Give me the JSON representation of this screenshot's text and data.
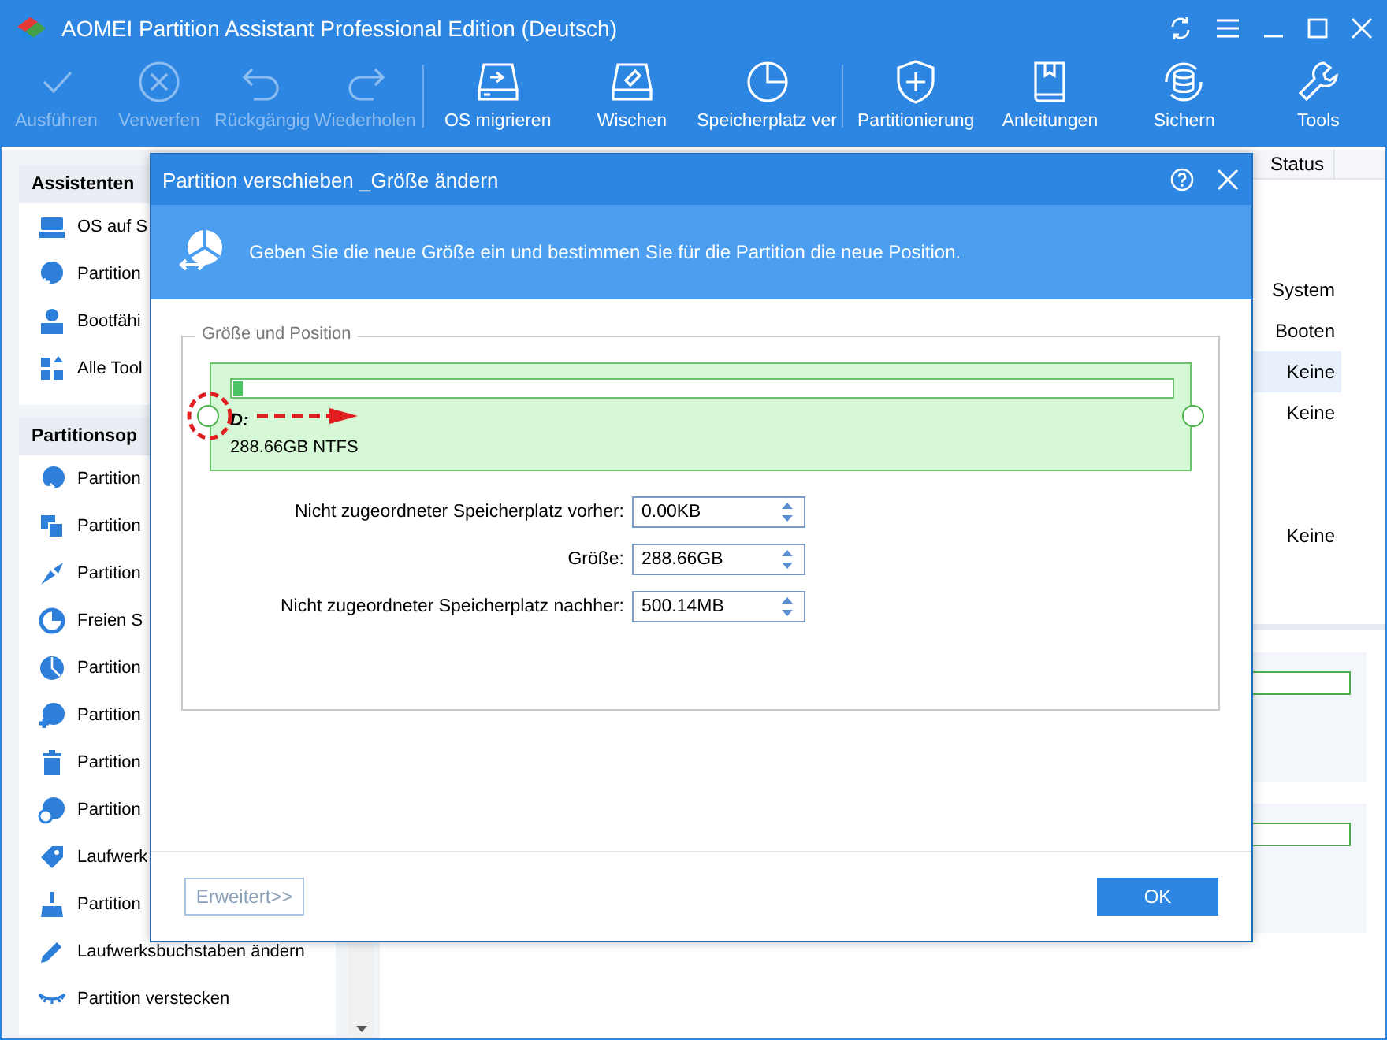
{
  "window": {
    "title": "AOMEI Partition Assistant Professional Edition (Deutsch)"
  },
  "toolbar": [
    [
      {
        "label": "Ausführen",
        "disabled": true
      },
      {
        "label": "Verwerfen",
        "disabled": true
      },
      {
        "label": "Rückgängig",
        "disabled": true
      },
      {
        "label": "Wiederholen",
        "disabled": true
      }
    ],
    [
      {
        "label": "OS migrieren",
        "disabled": false
      },
      {
        "label": "Wischen",
        "disabled": false
      },
      {
        "label": "Speicherplatz ver",
        "disabled": false
      }
    ],
    [
      {
        "label": "Partitionierung",
        "disabled": false
      },
      {
        "label": "Anleitungen",
        "disabled": false
      },
      {
        "label": "Sichern",
        "disabled": false
      },
      {
        "label": "Tools",
        "disabled": false
      }
    ]
  ],
  "sidebar": [
    {
      "title": "Assistenten",
      "items": [
        "OS auf S",
        "Partition",
        "Bootfähi",
        "Alle Tool"
      ]
    },
    {
      "title": "Partitionsop",
      "items": [
        "Partition",
        "Partition",
        "Partition",
        "Freien S",
        "Partition",
        "Partition",
        "Partition",
        "Partition",
        "Laufwerk",
        "Partition",
        "Laufwerksbuchstaben ändern",
        "Partition verstecken"
      ]
    }
  ],
  "table": {
    "columns": [
      "Status"
    ],
    "rows": [
      {
        "status": "System",
        "selected": false
      },
      {
        "status": "Booten",
        "selected": false
      },
      {
        "status": "Keine",
        "selected": true
      },
      {
        "status": "Keine",
        "selected": false
      },
      {
        "selected": false
      },
      {
        "selected": false
      },
      {
        "status": "Keine",
        "selected": false
      }
    ]
  },
  "dialog": {
    "title": "Partition verschieben _Größe ändern",
    "banner": "Geben Sie die neue Größe ein und bestimmen Sie für die Partition die neue Position.",
    "group_title": "Größe und Position",
    "partition": {
      "letter": "D:",
      "info": "288.66GB NTFS",
      "level": 0.01
    },
    "fields": [
      {
        "label": "Nicht zugeordneter Speicherplatz vorher:",
        "value": "0.00KB"
      },
      {
        "label": "Größe:",
        "value": "288.66GB"
      },
      {
        "label": "Nicht zugeordneter Speicherplatz nachher:",
        "value": "500.14MB"
      }
    ],
    "buttons": [
      {
        "label": "Erweitert>>",
        "kind": "secondary"
      },
      {
        "label": "OK",
        "kind": "primary"
      }
    ]
  }
}
